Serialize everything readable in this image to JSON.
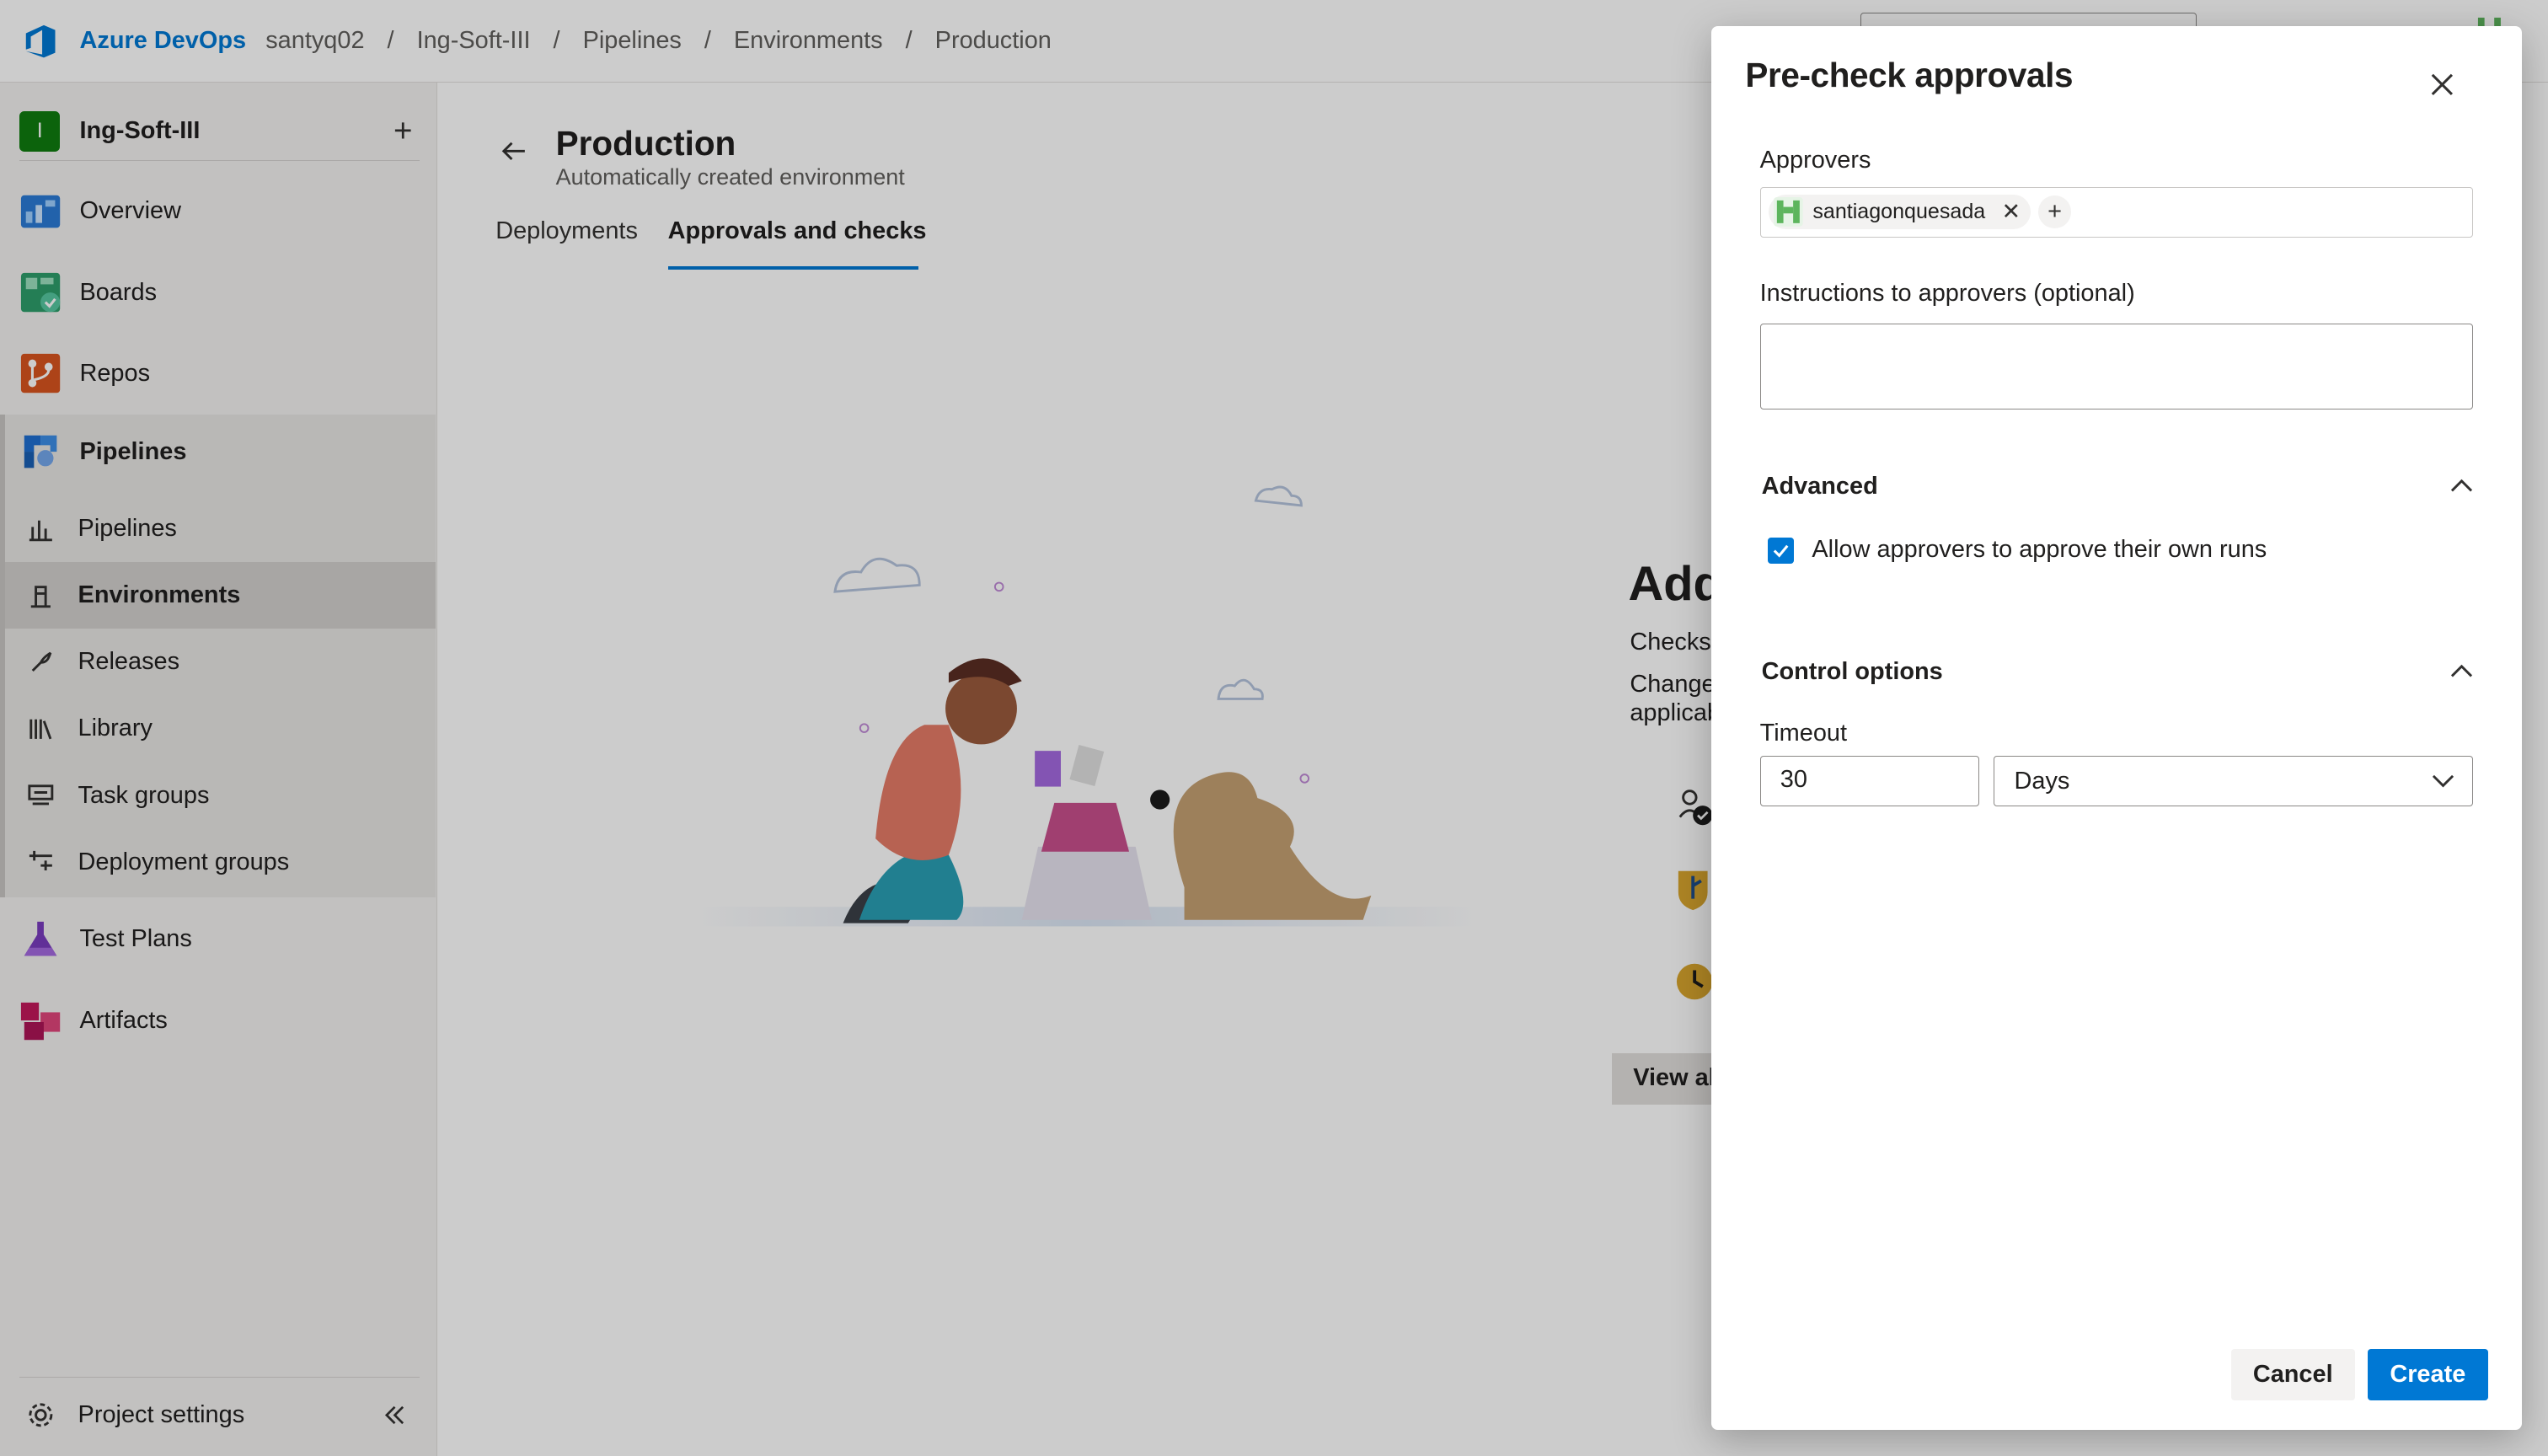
{
  "header": {
    "brand": "Azure DevOps",
    "breadcrumbs": [
      "santyq02",
      "Ing-Soft-III",
      "Pipelines",
      "Environments",
      "Production"
    ]
  },
  "sidebar": {
    "project_initial": "I",
    "project_name": "Ing-Soft-III",
    "items": {
      "overview": "Overview",
      "boards": "Boards",
      "repos": "Repos",
      "pipelines_group": "Pipelines",
      "pipelines": "Pipelines",
      "environments": "Environments",
      "releases": "Releases",
      "library": "Library",
      "task_groups": "Task groups",
      "deployment_groups": "Deployment groups",
      "test_plans": "Test Plans",
      "artifacts": "Artifacts"
    },
    "settings_label": "Project settings"
  },
  "page": {
    "title": "Production",
    "subtitle": "Automatically created environment",
    "tabs": [
      "Deployments",
      "Approvals and checks"
    ],
    "empty_title": "Add",
    "empty_text_1": "Checks",
    "empty_text_2a": "Change",
    "empty_text_2b": "applicab",
    "view_all": "View al"
  },
  "panel": {
    "title": "Pre-check approvals",
    "approvers_label": "Approvers",
    "approver_name": "santiagonquesada",
    "instructions_label": "Instructions to approvers (optional)",
    "instructions_value": "",
    "advanced_label": "Advanced",
    "allow_own_label": "Allow approvers to approve their own runs",
    "allow_own_checked": true,
    "control_label": "Control options",
    "timeout_label": "Timeout",
    "timeout_value": "30",
    "timeout_unit": "Days",
    "cancel_label": "Cancel",
    "create_label": "Create"
  },
  "colors": {
    "accent": "#0078d4",
    "project_badge": "#107c10"
  }
}
